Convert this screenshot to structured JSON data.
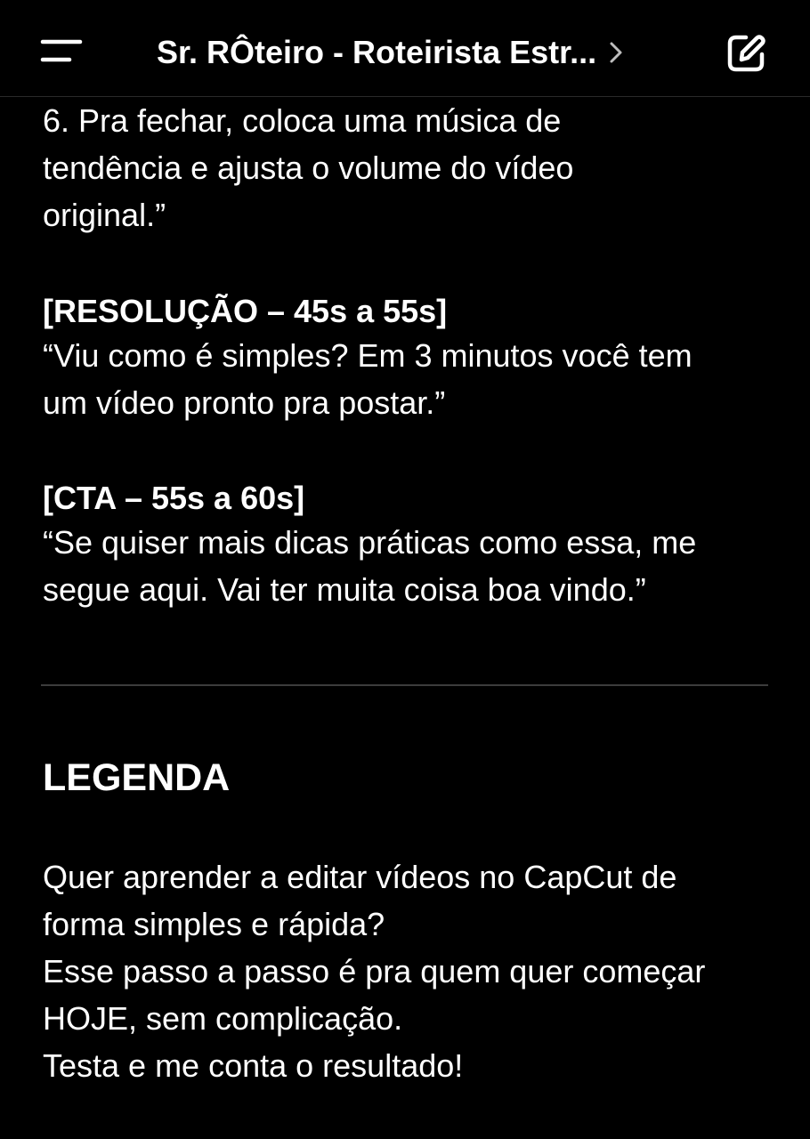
{
  "header": {
    "title": "Sr. RÔteiro - Roteirista Estr...",
    "menu_icon": "menu-icon",
    "chevron_icon": "chevron-right-icon",
    "edit_icon": "new-chat-edit-icon"
  },
  "message": {
    "step6": [
      "6. Pra fechar, coloca uma música de",
      "tendência e ajusta o volume do vídeo",
      "original.”"
    ],
    "resolucao_heading": "[RESOLUÇÃO – 45s a 55s]",
    "resolucao_text": [
      "“Viu como é simples? Em 3 minutos você tem",
      "um vídeo pronto pra postar.”"
    ],
    "cta_heading": "[CTA – 55s a 60s]",
    "cta_text": [
      "“Se quiser mais dicas práticas como essa, me",
      "segue aqui. Vai ter muita coisa boa vindo.”"
    ],
    "legenda_heading": "LEGENDA",
    "legenda_text": [
      "Quer aprender a editar vídeos no CapCut de",
      "forma simples e rápida?",
      "Esse passo a passo é pra quem quer começar",
      "HOJE, sem complicação.",
      "Testa e me conta o resultado!"
    ]
  },
  "colors": {
    "background": "#000000",
    "text": "#ffffff",
    "divider": "#3c3c3c"
  }
}
